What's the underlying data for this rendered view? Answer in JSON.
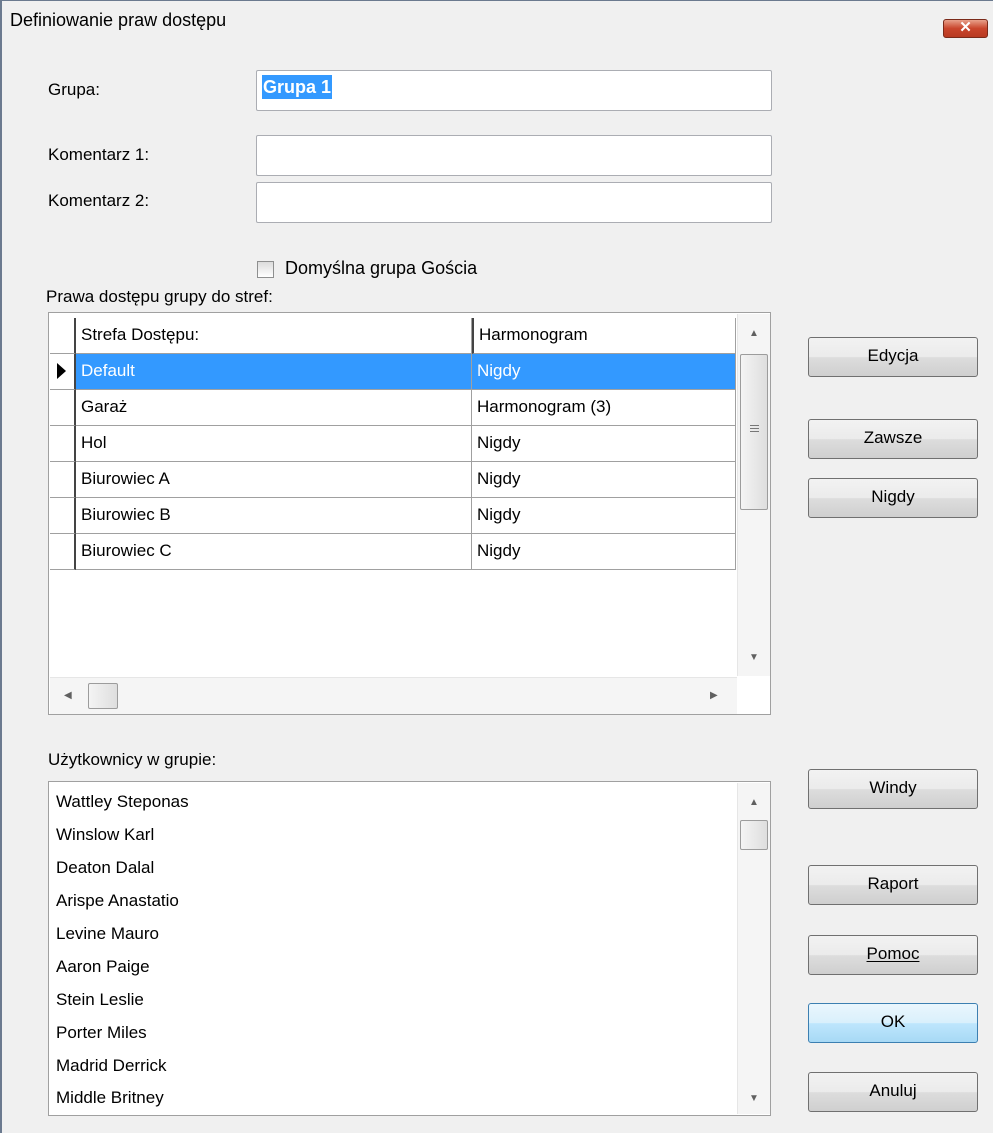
{
  "window": {
    "title": "Definiowanie praw dostępu",
    "close_label": "x"
  },
  "form": {
    "group_label": "Grupa:",
    "group_value": "Grupa 1",
    "comment1_label": "Komentarz 1:",
    "comment1_value": "",
    "comment2_label": "Komentarz 2:",
    "comment2_value": "",
    "guest_checkbox_label": "Domyślna grupa Gościa",
    "guest_checkbox_checked": false
  },
  "access_grid": {
    "section_label": "Prawa dostępu grupy do stref:",
    "columns": [
      "Strefa Dostępu:",
      "Harmonogram"
    ],
    "rows": [
      {
        "zone": "Default",
        "schedule": "Nigdy",
        "selected": true
      },
      {
        "zone": "Garaż",
        "schedule": "Harmonogram (3)",
        "selected": false
      },
      {
        "zone": "Hol",
        "schedule": "Nigdy",
        "selected": false
      },
      {
        "zone": "Biurowiec A",
        "schedule": "Nigdy",
        "selected": false
      },
      {
        "zone": "Biurowiec B",
        "schedule": "Nigdy",
        "selected": false
      },
      {
        "zone": "Biurowiec C",
        "schedule": "Nigdy",
        "selected": false
      }
    ]
  },
  "users": {
    "section_label": "Użytkownicy w grupie:",
    "items": [
      "Wattley Steponas",
      "Winslow Karl",
      "Deaton Dalal",
      "Arispe Anastatio",
      "Levine Mauro",
      "Aaron Paige",
      "Stein Leslie",
      "Porter Miles",
      "Madrid Derrick",
      "Middle Britney"
    ]
  },
  "buttons": {
    "edit": "Edycja",
    "always": "Zawsze",
    "never": "Nigdy",
    "elevators": "Windy",
    "report": "Raport",
    "help": "Pomoc",
    "ok": "OK",
    "cancel": "Anuluj"
  },
  "icons": {
    "close": "close-icon",
    "row_pointer": "row-pointer-icon",
    "scroll_up": "scroll-up-arrow-icon",
    "scroll_down": "scroll-down-arrow-icon",
    "scroll_left": "scroll-left-arrow-icon",
    "scroll_right": "scroll-right-arrow-icon"
  },
  "colors": {
    "selection": "#3399ff",
    "dialog_bg": "#f0f0f0",
    "close_button": "#c9452c"
  }
}
